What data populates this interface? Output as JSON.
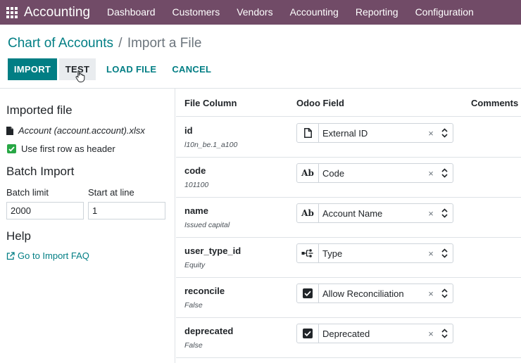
{
  "navbar": {
    "app_name": "Accounting",
    "menu": [
      "Dashboard",
      "Customers",
      "Vendors",
      "Accounting",
      "Reporting",
      "Configuration"
    ]
  },
  "breadcrumb": {
    "parent": "Chart of Accounts",
    "separator": "/",
    "current": "Import a File"
  },
  "buttons": {
    "import": "IMPORT",
    "test": "TEST",
    "load_file": "LOAD FILE",
    "cancel": "CANCEL"
  },
  "sidebar": {
    "imported_file_title": "Imported file",
    "file_name": "Account (account.account).xlsx",
    "first_row_header": "Use first row as header",
    "batch_title": "Batch Import",
    "batch_limit_label": "Batch limit",
    "batch_limit_value": "2000",
    "start_line_label": "Start at line",
    "start_line_value": "1",
    "help_title": "Help",
    "faq_link": "Go to Import FAQ"
  },
  "table": {
    "headers": {
      "file_column": "File Column",
      "odoo_field": "Odoo Field",
      "comments": "Comments"
    },
    "rows": [
      {
        "column": "id",
        "sample": "l10n_be.1_a100",
        "field": "External ID",
        "icon": "file-icon"
      },
      {
        "column": "code",
        "sample": "101100",
        "field": "Code",
        "icon": "text-ab-icon"
      },
      {
        "column": "name",
        "sample": "Issued capital",
        "field": "Account Name",
        "icon": "text-ab-icon"
      },
      {
        "column": "user_type_id",
        "sample": "Equity",
        "field": "Type",
        "icon": "relation-icon"
      },
      {
        "column": "reconcile",
        "sample": "False",
        "field": "Allow Reconciliation",
        "icon": "checkbox-icon"
      },
      {
        "column": "deprecated",
        "sample": "False",
        "field": "Deprecated",
        "icon": "checkbox-icon"
      }
    ],
    "ab_glyph": "Ab",
    "clear_glyph": "×"
  },
  "colors": {
    "navbar": "#714B67",
    "primary": "#017e84",
    "checkbox": "#28a745"
  }
}
